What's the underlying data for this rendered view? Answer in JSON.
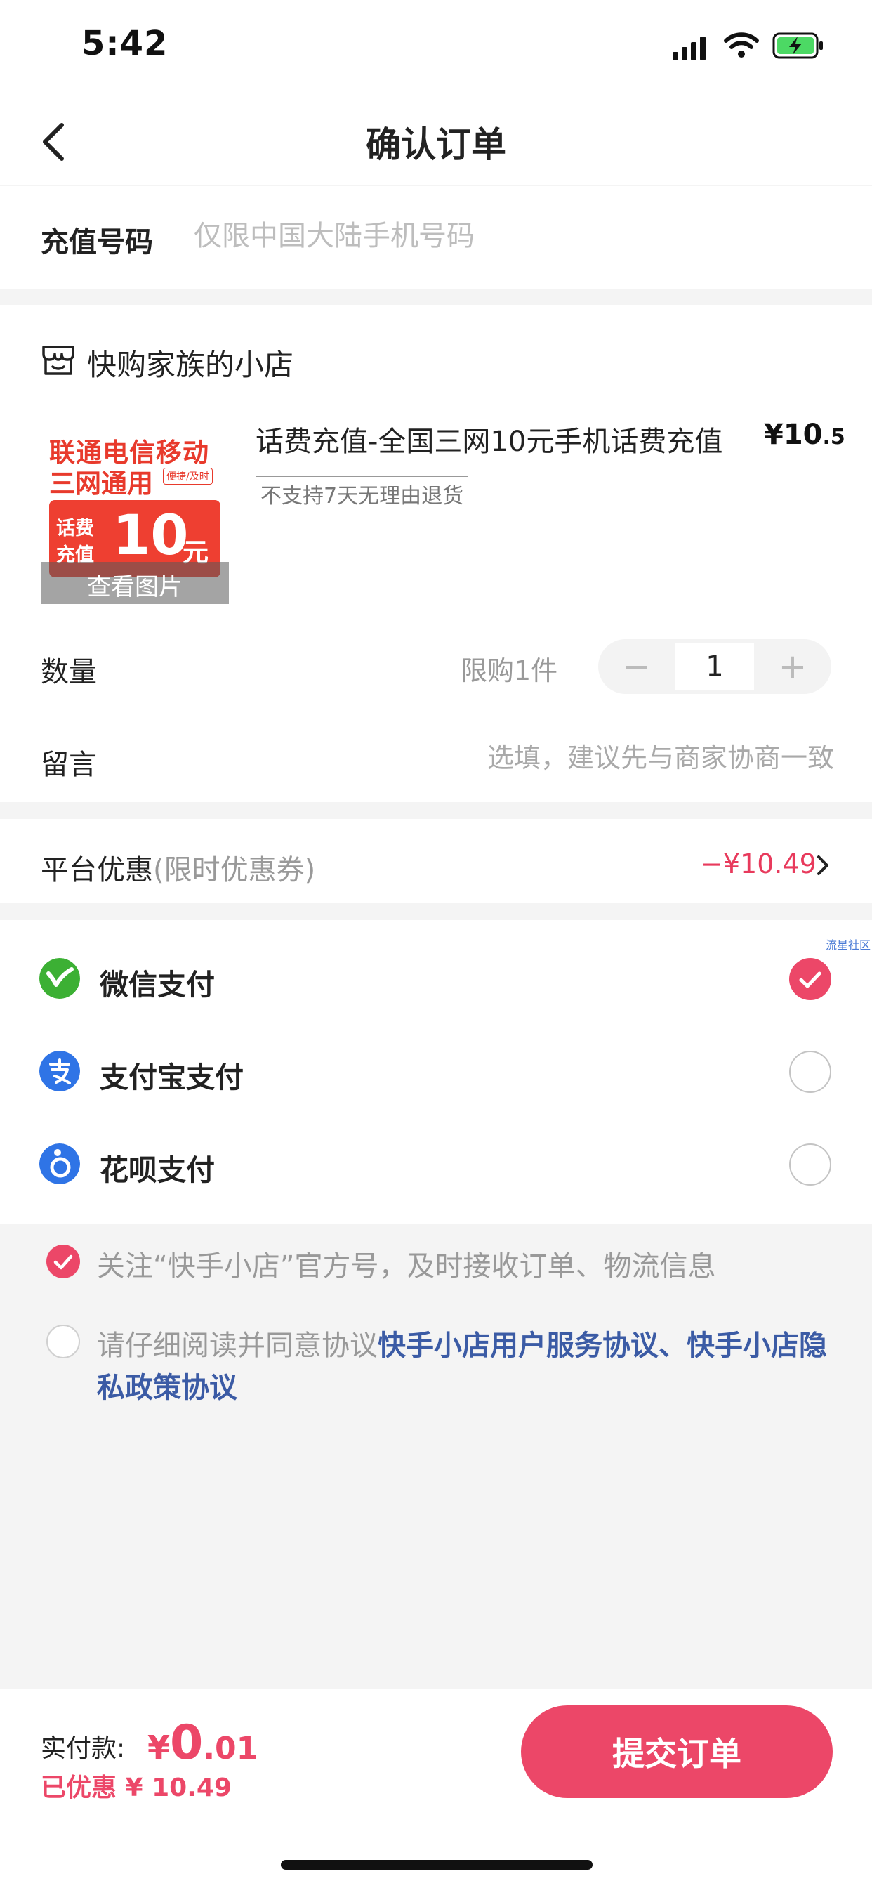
{
  "status_bar": {
    "time": "5:42"
  },
  "header": {
    "title": "确认订单"
  },
  "phone": {
    "label": "充值号码",
    "placeholder": "仅限中国大陆手机号码"
  },
  "shop": {
    "name": "快购家族的小店"
  },
  "product": {
    "thumb_line1": "联通电信移动",
    "thumb_line2": "三网通用",
    "thumb_tag": "便捷/及时",
    "thumb_small1": "话费",
    "thumb_small2": "充值",
    "thumb_number": "10",
    "thumb_unit": "元",
    "thumb_overlay": "查看图片",
    "title": "话费充值-全国三网10元手机话费充值",
    "price_symbol": "¥",
    "price_int": "10",
    "price_dec": ".5",
    "no_return": "不支持7天无理由退货"
  },
  "quantity": {
    "label": "数量",
    "limit": "限购1件",
    "value": "1",
    "minus": "−",
    "plus": "+"
  },
  "message": {
    "label": "留言",
    "placeholder": "选填，建议先与商家协商一致"
  },
  "coupon": {
    "label": "平台优惠",
    "sub": "(限时优惠券)",
    "value": "−¥10.49"
  },
  "payment": {
    "watermark": "流星社区",
    "methods": [
      {
        "label": "微信支付",
        "icon": "wechat-pay-icon",
        "color": "#3cb034",
        "checked": true
      },
      {
        "label": "支付宝支付",
        "icon": "alipay-icon",
        "color": "#2f74e6",
        "checked": false
      },
      {
        "label": "花呗支付",
        "icon": "huabei-icon",
        "color": "#2f74e6",
        "checked": false
      }
    ]
  },
  "agreements": {
    "follow": "关注“快手小店”官方号，及时接收订单、物流信息",
    "agree_prefix": "请仔细阅读并同意协议",
    "agree_link1": "快手小店用户服务协议",
    "agree_sep": "、",
    "agree_link2": "快手小店隐私政策协议"
  },
  "footer": {
    "pay_label": "实付款:",
    "currency": "¥",
    "amount_int": "0",
    "amount_dec": ".01",
    "saved": "已优惠 ¥ 10.49",
    "submit": "提交订单"
  },
  "colors": {
    "accent": "#ec4768",
    "link": "#3b5ba5",
    "thumb_red": "#ee3f31"
  }
}
